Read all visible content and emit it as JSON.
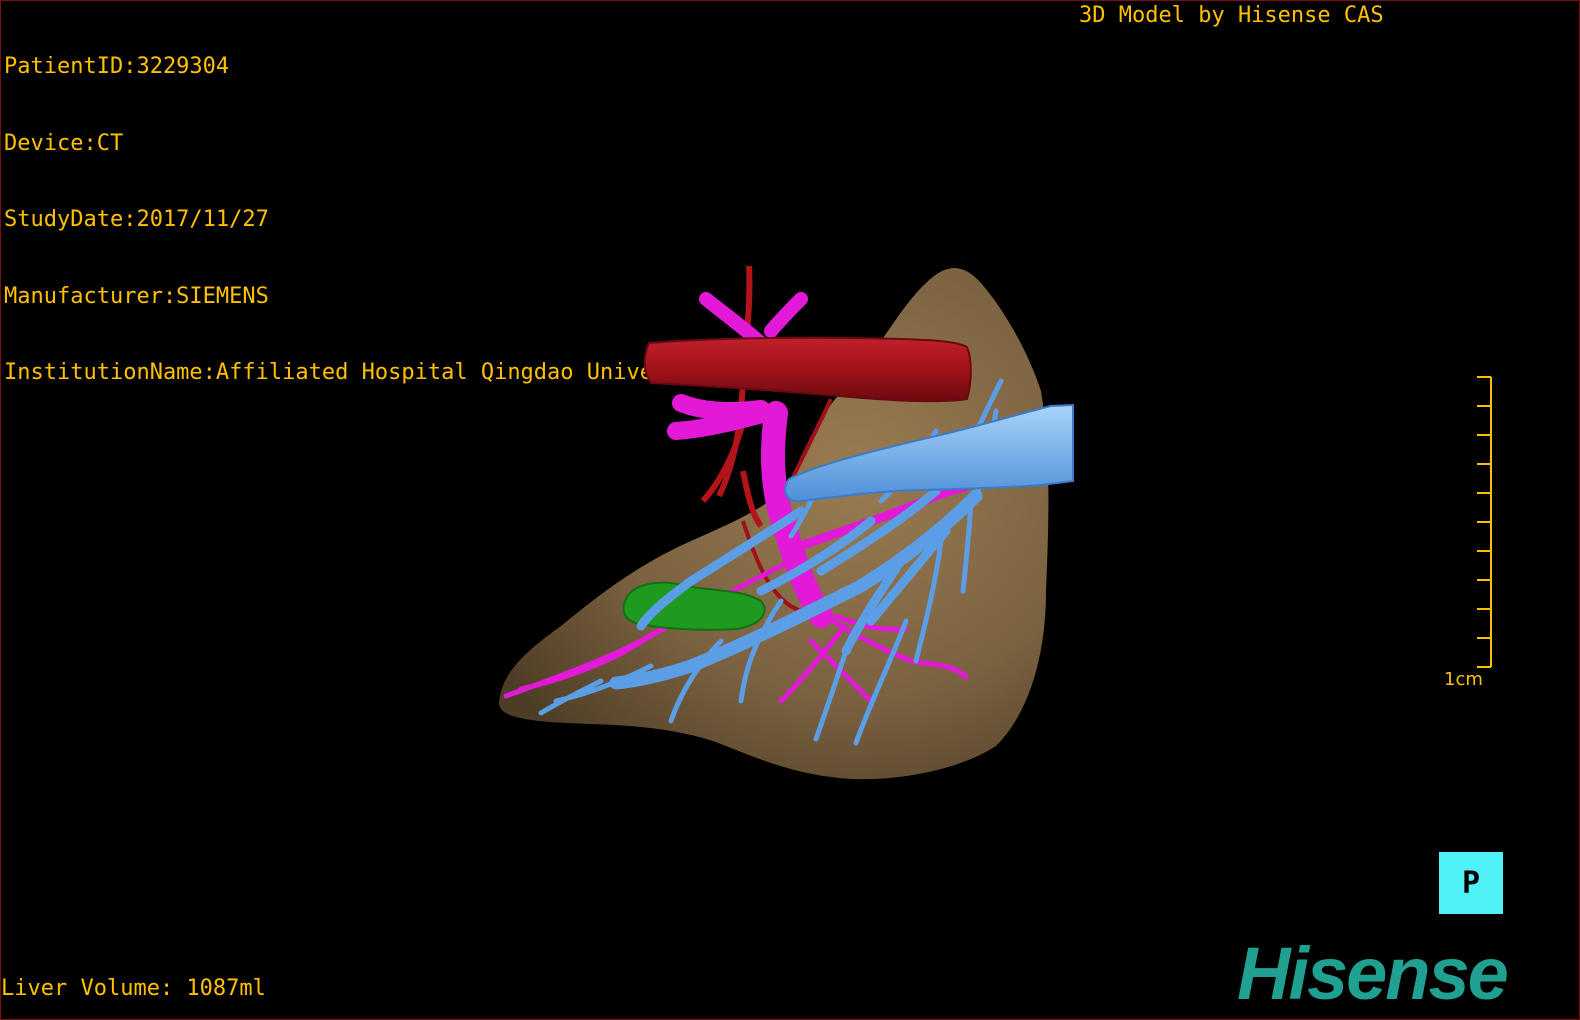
{
  "patient_info": {
    "patient_id": "PatientID:3229304",
    "device": "Device:CT",
    "study_date": "StudyDate:2017/11/27",
    "manufacturer": "Manufacturer:SIEMENS",
    "institution": "InstitutionName:Affiliated Hospital Qingdao University-C"
  },
  "header": {
    "model_credit": "3D Model by Hisense CAS"
  },
  "footer": {
    "liver_volume": "Liver Volume: 1087ml"
  },
  "scale_bar": {
    "label": "1cm",
    "tick_count": 10
  },
  "orientation_button": {
    "label": "P"
  },
  "logo": {
    "text": "Hisense"
  },
  "colors": {
    "overlay_text": "#ffc000",
    "liver": "#7a6140",
    "artery": "#b3141a",
    "portal_vein": "#e21ad8",
    "hepatic_vein": "#5b9ee6",
    "ivc": "#8ec4f2",
    "gallbladder": "#1f9a1f",
    "orientation_button": "#4ff0f6",
    "logo": "#1fa090"
  },
  "model_structures": [
    "liver-icon",
    "artery-icon",
    "portal-vein-icon",
    "hepatic-vein-icon",
    "ivc-icon",
    "gallbladder-icon"
  ]
}
